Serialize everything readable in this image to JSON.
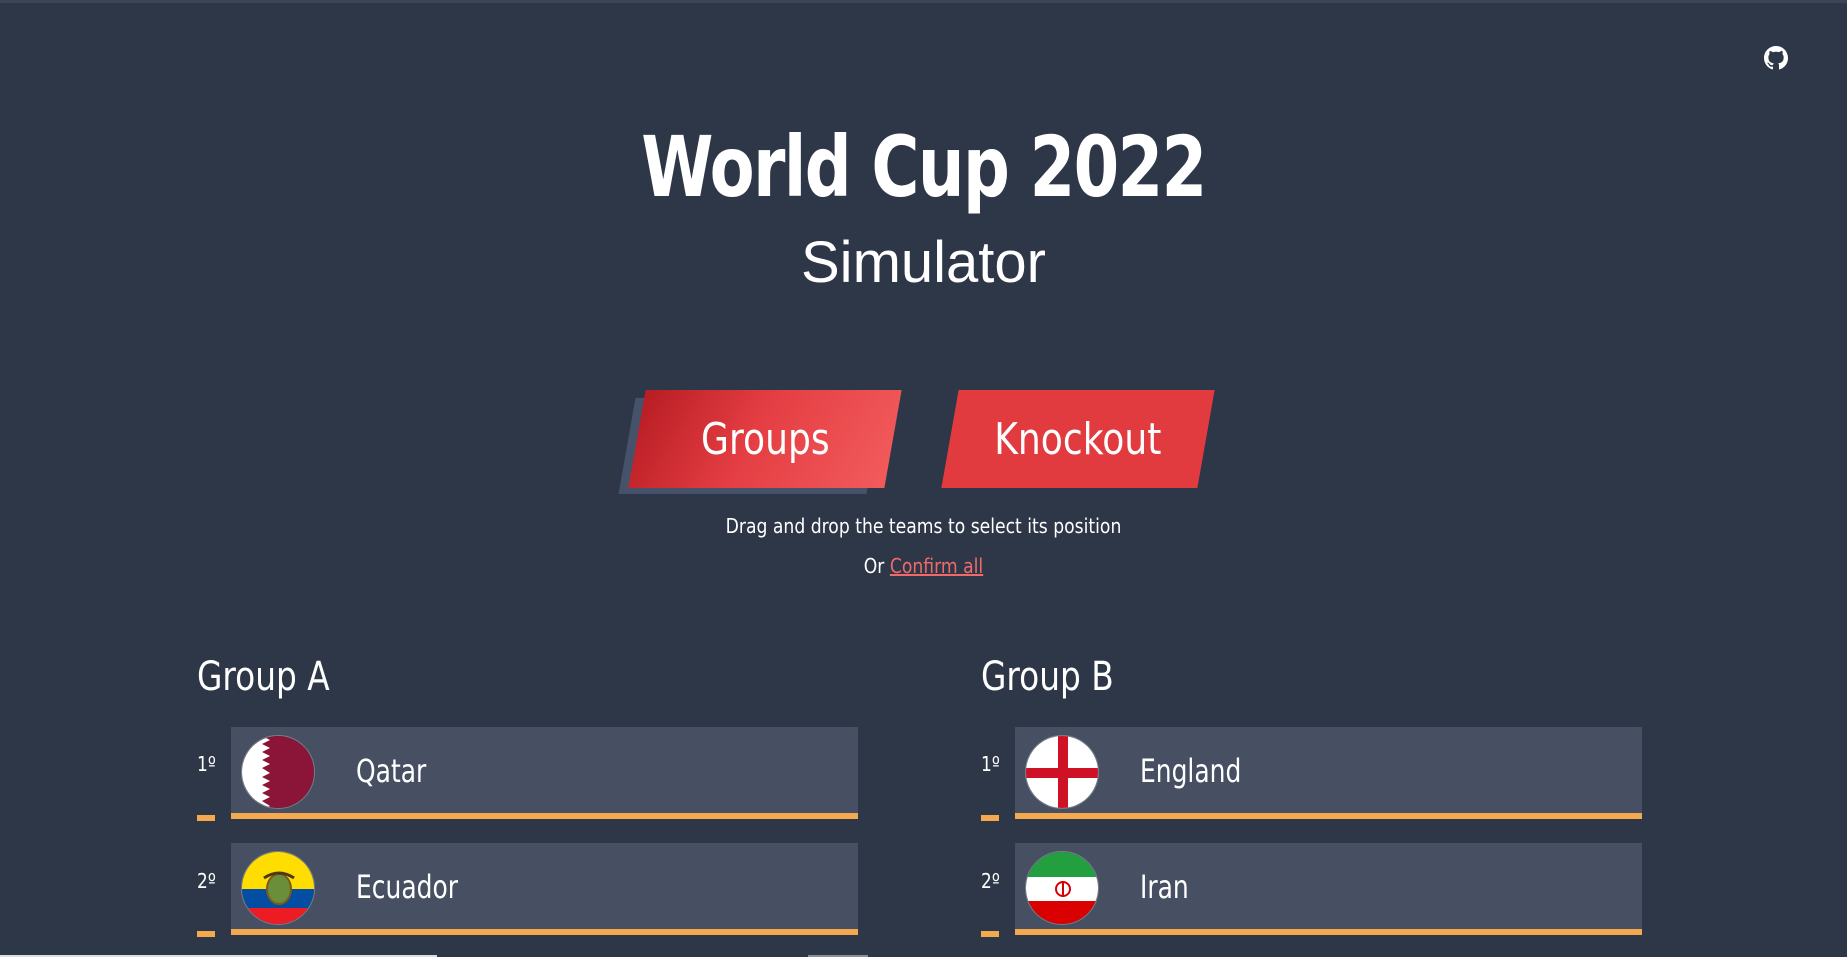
{
  "header": {
    "title": "World Cup 2022",
    "subtitle": "Simulator"
  },
  "github": {
    "icon": "github-icon"
  },
  "tabs": {
    "groups_label": "Groups",
    "knockout_label": "Knockout"
  },
  "instructions": {
    "drag_text": "Drag and drop the teams to select its position",
    "or_text": "Or",
    "confirm_all_label": "Confirm all"
  },
  "groups": [
    {
      "title": "Group A",
      "teams": [
        {
          "rank": "1º",
          "name": "Qatar",
          "flag": "qatar-flag"
        },
        {
          "rank": "2º",
          "name": "Ecuador",
          "flag": "ecuador-flag"
        }
      ]
    },
    {
      "title": "Group B",
      "teams": [
        {
          "rank": "1º",
          "name": "England",
          "flag": "england-flag"
        },
        {
          "rank": "2º",
          "name": "Iran",
          "flag": "iran-flag"
        }
      ]
    }
  ],
  "colors": {
    "background": "#2e3748",
    "card": "#475063",
    "accent_orange": "#f5a94f",
    "button_red": "#e23b3f",
    "link_red": "#f06a6a"
  }
}
